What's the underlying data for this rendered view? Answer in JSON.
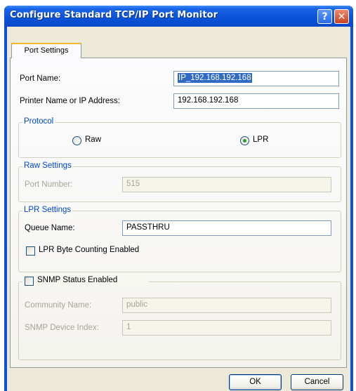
{
  "window": {
    "title": "Configure Standard TCP/IP Port Monitor",
    "help_label": "?",
    "close_label": "✕"
  },
  "tabs": [
    {
      "label": "Port Settings"
    }
  ],
  "port_name": {
    "label": "Port Name:",
    "value": "IP_192.168.192.168"
  },
  "printer_address": {
    "label": "Printer Name or IP Address:",
    "value": "192.168.192.168"
  },
  "protocol": {
    "title": "Protocol",
    "options": [
      {
        "label": "Raw",
        "selected": false
      },
      {
        "label": "LPR",
        "selected": true
      }
    ]
  },
  "raw_settings": {
    "title": "Raw Settings",
    "port_number_label": "Port Number:",
    "port_number_value": "515"
  },
  "lpr_settings": {
    "title": "LPR Settings",
    "queue_name_label": "Queue Name:",
    "queue_name_value": "PASSTHRU",
    "byte_counting_label": "LPR Byte Counting Enabled",
    "byte_counting_checked": false
  },
  "snmp": {
    "label": "SNMP Status Enabled",
    "checked": false,
    "community_label": "Community Name:",
    "community_value": "public",
    "device_index_label": "SNMP Device Index:",
    "device_index_value": "1"
  },
  "buttons": {
    "ok": "OK",
    "cancel": "Cancel"
  },
  "colors": {
    "title_bar": "#0a52dc",
    "group_title": "#0046d5",
    "dialog_bg": "#ece9d8"
  }
}
